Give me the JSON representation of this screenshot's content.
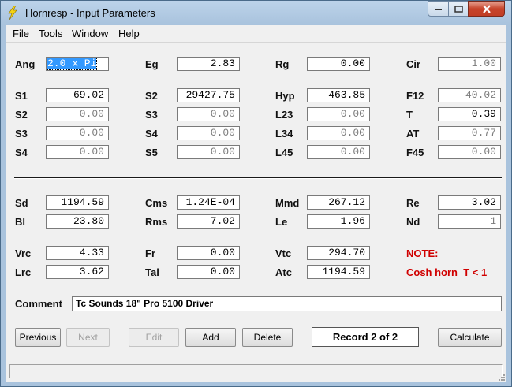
{
  "window": {
    "title": "Hornresp - Input Parameters"
  },
  "menu": [
    "File",
    "Tools",
    "Window",
    "Help"
  ],
  "params": {
    "Ang": {
      "label": "Ang",
      "value": "2.0 x Pi"
    },
    "Eg": {
      "label": "Eg",
      "value": "2.83"
    },
    "Rg": {
      "label": "Rg",
      "value": "0.00"
    },
    "Cir": {
      "label": "Cir",
      "value": "1.00"
    },
    "S1": {
      "label": "S1",
      "value": "69.02"
    },
    "S2a": {
      "label": "S2",
      "value": "29427.75"
    },
    "Hyp": {
      "label": "Hyp",
      "value": "463.85"
    },
    "F12": {
      "label": "F12",
      "value": "40.02"
    },
    "S2": {
      "label": "S2",
      "value": "0.00"
    },
    "S3a": {
      "label": "S3",
      "value": "0.00"
    },
    "L23": {
      "label": "L23",
      "value": "0.00"
    },
    "T": {
      "label": "T",
      "value": "0.39"
    },
    "S3": {
      "label": "S3",
      "value": "0.00"
    },
    "S4a": {
      "label": "S4",
      "value": "0.00"
    },
    "L34": {
      "label": "L34",
      "value": "0.00"
    },
    "AT": {
      "label": "AT",
      "value": "0.77"
    },
    "S4": {
      "label": "S4",
      "value": "0.00"
    },
    "S5": {
      "label": "S5",
      "value": "0.00"
    },
    "L45": {
      "label": "L45",
      "value": "0.00"
    },
    "F45": {
      "label": "F45",
      "value": "0.00"
    },
    "Sd": {
      "label": "Sd",
      "value": "1194.59"
    },
    "Cms": {
      "label": "Cms",
      "value": "1.24E-04"
    },
    "Mmd": {
      "label": "Mmd",
      "value": "267.12"
    },
    "Re": {
      "label": "Re",
      "value": "3.02"
    },
    "Bl": {
      "label": "Bl",
      "value": "23.80"
    },
    "Rms": {
      "label": "Rms",
      "value": "7.02"
    },
    "Le": {
      "label": "Le",
      "value": "1.96"
    },
    "Nd": {
      "label": "Nd",
      "value": "1"
    },
    "Vrc": {
      "label": "Vrc",
      "value": "4.33"
    },
    "Fr": {
      "label": "Fr",
      "value": "0.00"
    },
    "Vtc": {
      "label": "Vtc",
      "value": "294.70"
    },
    "Lrc": {
      "label": "Lrc",
      "value": "3.62"
    },
    "Tal": {
      "label": "Tal",
      "value": "0.00"
    },
    "Atc": {
      "label": "Atc",
      "value": "1194.59"
    }
  },
  "note": {
    "title": "NOTE:",
    "text": "Cosh horn  T < 1"
  },
  "comment": {
    "label": "Comment",
    "value": "Tc Sounds 18\" Pro 5100 Driver"
  },
  "buttons": {
    "previous": "Previous",
    "next": "Next",
    "edit": "Edit",
    "add": "Add",
    "delete": "Delete",
    "calculate": "Calculate"
  },
  "record": "Record 2 of 2",
  "colors": {
    "note": "#d00000",
    "selection": "#3399ff",
    "close": "#c7442b"
  }
}
